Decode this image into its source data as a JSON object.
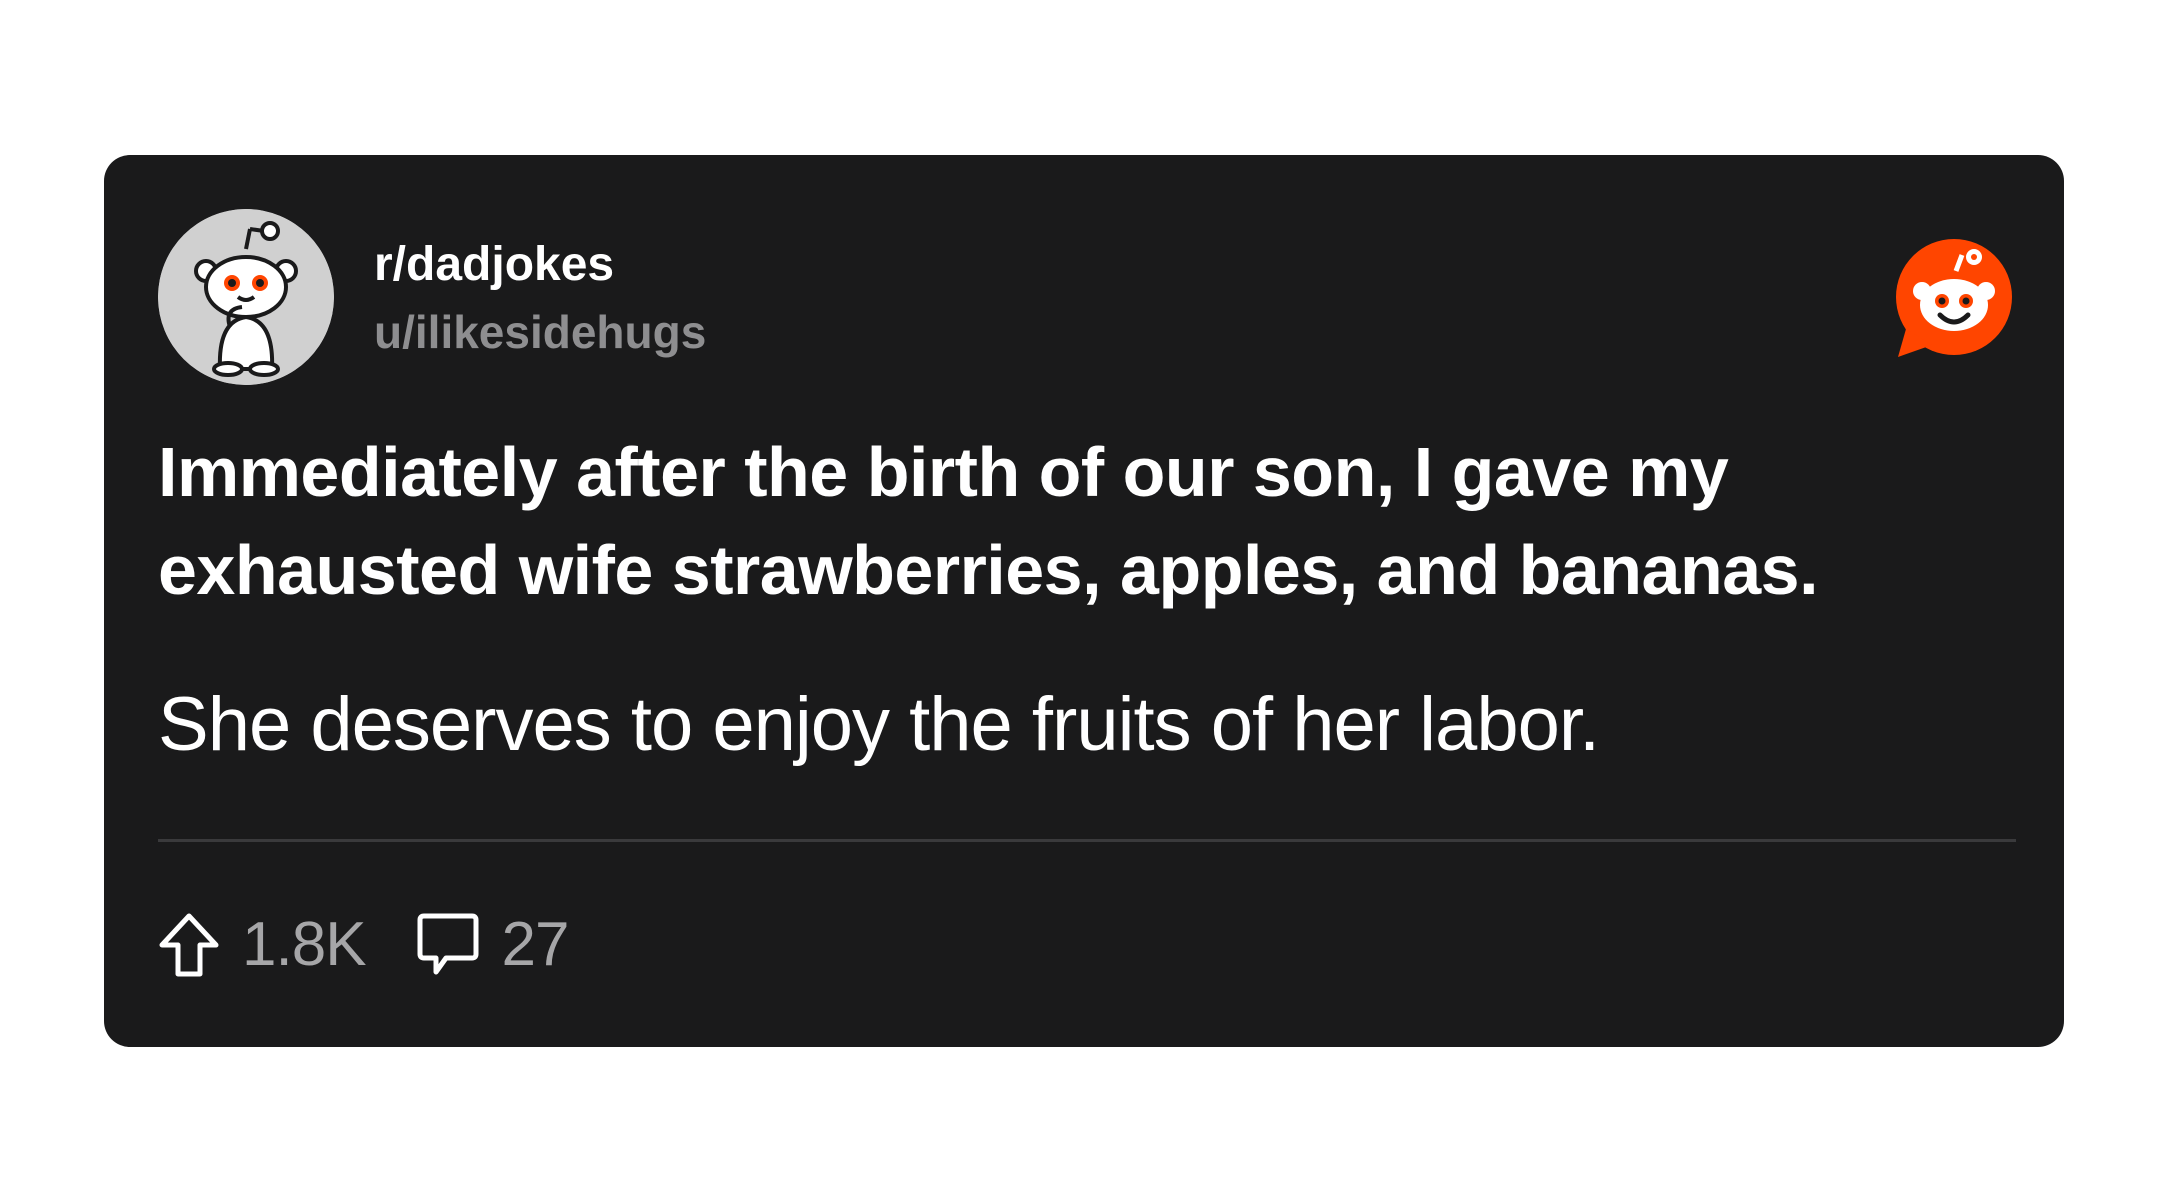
{
  "post": {
    "subreddit": "r/dadjokes",
    "username": "u/ilikesidehugs",
    "title": "Immediately after the birth of our son, I gave my exhausted wife strawberries, apples, and bananas.",
    "body": "She deserves to enjoy the fruits of her labor."
  },
  "actions": {
    "upvotes": "1.8K",
    "comments": "27"
  },
  "icons": {
    "avatar": "snoo-avatar-icon",
    "brand": "reddit-logo-icon",
    "upvote": "upvote-arrow-icon",
    "comment": "comment-bubble-icon"
  },
  "colors": {
    "card_background": "#1a1a1b",
    "brand_orange": "#ff4500",
    "secondary_text": "#8e8e90",
    "divider": "#3a3a3c"
  }
}
